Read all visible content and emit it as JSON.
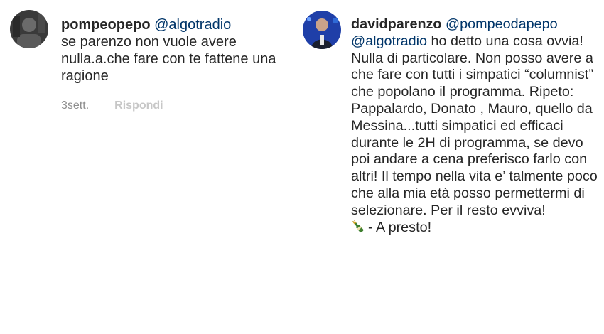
{
  "comments": [
    {
      "username": "pompeopepo",
      "mention": "@algotradio",
      "text": "se parenzo non vuole avere nulla.a.che fare con te fattene una ragione",
      "time": "3sett.",
      "reply_label": "Rispondi"
    },
    {
      "username": "davidparenzo",
      "mentions": [
        "@pompeodapepo",
        "@algotradio"
      ],
      "text": "ho detto una cosa ovvia! Nulla di particolare. Non posso avere a che fare con tutti i simpatici “columnist” che popolano il programma. Ripeto: Pappalardo, Donato , Mauro, quello da Messina...tutti simpatici ed efficaci durante le 2H di programma, se devo poi andare a cena preferisco farlo con altri! Il tempo nella vita e’ talmente poco che alla mia età posso permettermi di selezionare. Per il resto evviva!",
      "tail_text": "- A presto!",
      "emoji_icon": "champagne-bottle-icon"
    }
  ],
  "colors": {
    "text": "#262626",
    "mention": "#003569",
    "meta": "#8e8e8e",
    "reply": "#c7c7c7"
  }
}
